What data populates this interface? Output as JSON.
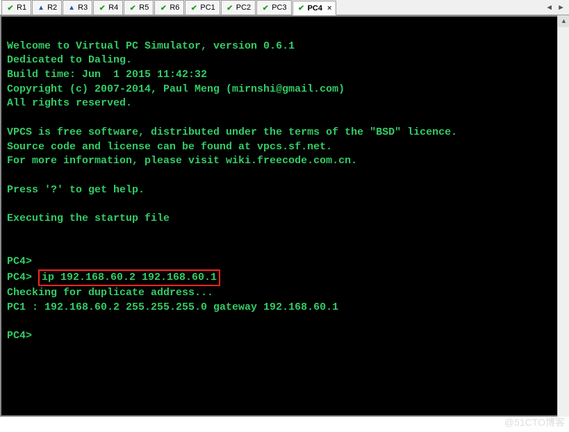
{
  "tabs": [
    {
      "label": "R1",
      "status": "check",
      "active": false
    },
    {
      "label": "R2",
      "status": "warn",
      "active": false
    },
    {
      "label": "R3",
      "status": "warn",
      "active": false
    },
    {
      "label": "R4",
      "status": "check",
      "active": false
    },
    {
      "label": "R5",
      "status": "check",
      "active": false
    },
    {
      "label": "R6",
      "status": "check",
      "active": false
    },
    {
      "label": "PC1",
      "status": "check",
      "active": false
    },
    {
      "label": "PC2",
      "status": "check",
      "active": false
    },
    {
      "label": "PC3",
      "status": "check",
      "active": false
    },
    {
      "label": "PC4",
      "status": "check",
      "active": true
    }
  ],
  "tab_close_glyph": "×",
  "nav": {
    "prev": "◄",
    "next": "►"
  },
  "terminal": {
    "lines": [
      "",
      "Welcome to Virtual PC Simulator, version 0.6.1",
      "Dedicated to Daling.",
      "Build time: Jun  1 2015 11:42:32",
      "Copyright (c) 2007-2014, Paul Meng (mirnshi@gmail.com)",
      "All rights reserved.",
      "",
      "VPCS is free software, distributed under the terms of the \"BSD\" licence.",
      "Source code and license can be found at vpcs.sf.net.",
      "For more information, please visit wiki.freecode.com.cn.",
      "",
      "Press '?' to get help.",
      "",
      "Executing the startup file",
      "",
      "",
      "PC4>"
    ],
    "highlighted_prompt_prefix": "PC4> ",
    "highlighted_command": "ip 192.168.60.2 192.168.60.1",
    "after_highlight_lines": [
      "Checking for duplicate address...",
      "PC1 : 192.168.60.2 255.255.255.0 gateway 192.168.60.1",
      "",
      "PC4>"
    ]
  },
  "watermark": "@51CTO博客"
}
